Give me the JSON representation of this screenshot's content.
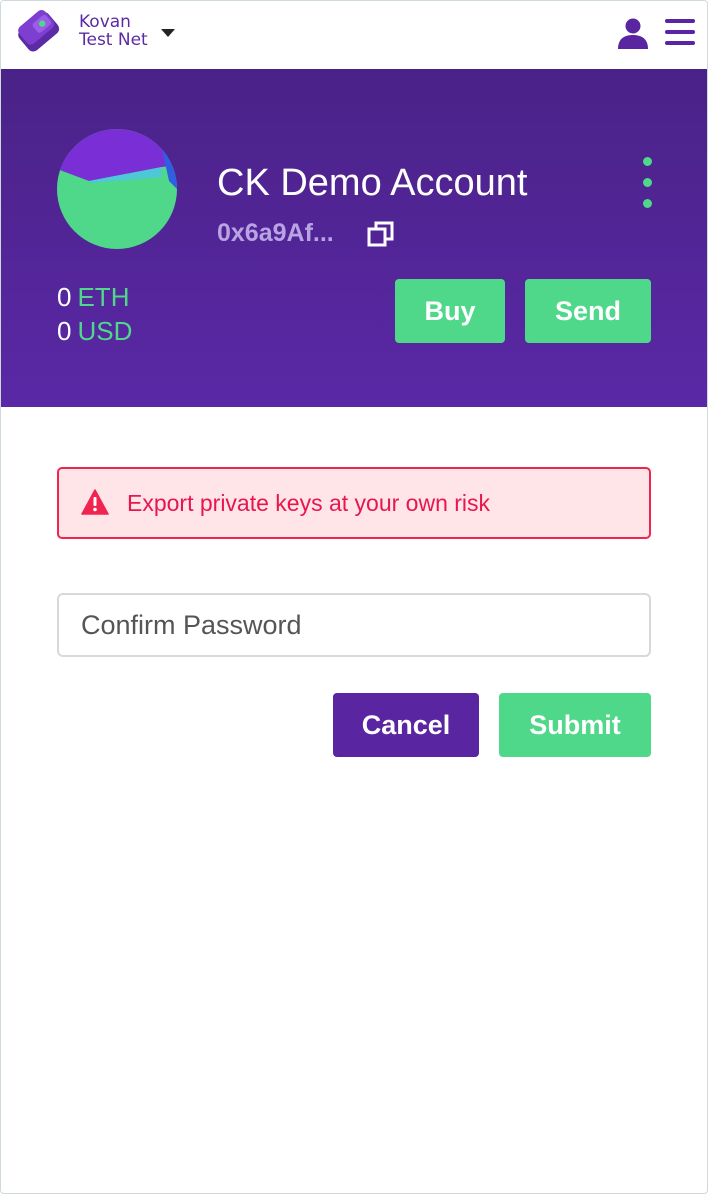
{
  "topbar": {
    "network_line1": "Kovan",
    "network_line2": "Test Net",
    "icons": {
      "logo": "wallet-logo-icon",
      "dropdown": "chevron-down-icon",
      "user": "user-icon",
      "menu": "hamburger-menu-icon"
    }
  },
  "account": {
    "name": "CK Demo Account",
    "address": "0x6a9Af...",
    "avatar": "identicon-avatar",
    "balances": [
      {
        "amount": "0",
        "unit": "ETH"
      },
      {
        "amount": "0",
        "unit": "USD"
      }
    ],
    "buy_label": "Buy",
    "send_label": "Send"
  },
  "warning": {
    "icon": "warning-triangle-icon",
    "text": "Export private keys at your own risk"
  },
  "form": {
    "password_placeholder": "Confirm Password",
    "password_value": "",
    "cancel_label": "Cancel",
    "submit_label": "Submit"
  },
  "colors": {
    "purple_primary": "#5a25a0",
    "purple_header": "#4a2287",
    "green_accent": "#4fd88a",
    "danger": "#e8164d",
    "danger_bg": "#ffe4e8"
  }
}
